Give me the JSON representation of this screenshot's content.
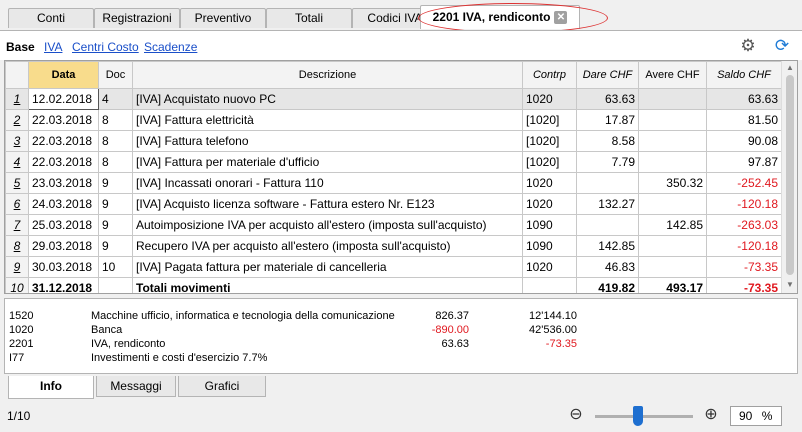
{
  "tabs": [
    "Conti",
    "Registrazioni",
    "Preventivo",
    "Totali",
    "Codici IVA",
    "2201 IVA, rendiconto"
  ],
  "views": [
    "Base",
    "IVA",
    "Centri Costo",
    "Scadenze"
  ],
  "icons": {
    "settings": "gear-icon",
    "refresh": "refresh-icon",
    "close": "close-icon",
    "zoom_out": "zoom-out-icon",
    "zoom_in": "zoom-in-icon"
  },
  "colors": {
    "negative": "#e0181f",
    "selected_header": "#f8dc8c",
    "highlight_ellipse": "#dd3333"
  },
  "table": {
    "headers": [
      "Data",
      "Doc",
      "Descrizione",
      "Contrp",
      "Dare CHF",
      "Avere CHF",
      "Saldo CHF"
    ],
    "rows": [
      {
        "n": "1",
        "date": "12.02.2018",
        "doc": "4",
        "desc": "[IVA] Acquistato nuovo PC",
        "contrp": "1020",
        "dare": "63.63",
        "avere": "",
        "saldo": "63.63"
      },
      {
        "n": "2",
        "date": "22.03.2018",
        "doc": "8",
        "desc": "[IVA] Fattura elettricità",
        "contrp": "[1020]",
        "dare": "17.87",
        "avere": "",
        "saldo": "81.50"
      },
      {
        "n": "3",
        "date": "22.03.2018",
        "doc": "8",
        "desc": "[IVA] Fattura telefono",
        "contrp": "[1020]",
        "dare": "8.58",
        "avere": "",
        "saldo": "90.08"
      },
      {
        "n": "4",
        "date": "22.03.2018",
        "doc": "8",
        "desc": "[IVA] Fattura per materiale d'ufficio",
        "contrp": "[1020]",
        "dare": "7.79",
        "avere": "",
        "saldo": "97.87"
      },
      {
        "n": "5",
        "date": "23.03.2018",
        "doc": "9",
        "desc": "[IVA] Incassati onorari - Fattura 110",
        "contrp": "1020",
        "dare": "",
        "avere": "350.32",
        "saldo": "-252.45"
      },
      {
        "n": "6",
        "date": "24.03.2018",
        "doc": "9",
        "desc": "[IVA] Acquisto licenza software - Fattura estero Nr. E123",
        "contrp": "1020",
        "dare": "132.27",
        "avere": "",
        "saldo": "-120.18"
      },
      {
        "n": "7",
        "date": "25.03.2018",
        "doc": "9",
        "desc": "Autoimposizione IVA per acquisto all'estero (imposta sull'acquisto)",
        "contrp": "1090",
        "dare": "",
        "avere": "142.85",
        "saldo": "-263.03"
      },
      {
        "n": "8",
        "date": "29.03.2018",
        "doc": "9",
        "desc": "Recupero IVA per acquisto all'estero (imposta sull'acquisto)",
        "contrp": "1090",
        "dare": "142.85",
        "avere": "",
        "saldo": "-120.18"
      },
      {
        "n": "9",
        "date": "30.03.2018",
        "doc": "10",
        "desc": "[IVA] Pagata fattura per materiale di cancelleria",
        "contrp": "1020",
        "dare": "46.83",
        "avere": "",
        "saldo": "-73.35"
      },
      {
        "n": "10",
        "date": "31.12.2018",
        "doc": "",
        "desc": "Totali movimenti",
        "contrp": "",
        "dare": "419.82",
        "avere": "493.17",
        "saldo": "-73.35"
      }
    ]
  },
  "info_lines": [
    {
      "code": "1520",
      "desc": "Macchine ufficio, informatica e tecnologia della comunicazione",
      "v1": "826.37",
      "v2": "12'144.10",
      "v1neg": false,
      "v2neg": false
    },
    {
      "code": "1020",
      "desc": "Banca",
      "v1": "-890.00",
      "v2": "42'536.00",
      "v1neg": true,
      "v2neg": false
    },
    {
      "code": "2201",
      "desc": "IVA, rendiconto",
      "v1": "63.63",
      "v2": "-73.35",
      "v1neg": false,
      "v2neg": true
    },
    {
      "code": "I77",
      "desc": "Investimenti e costi d'esercizio 7.7%",
      "v1": "",
      "v2": "",
      "v1neg": false,
      "v2neg": false
    }
  ],
  "bottom_tabs": [
    "Info",
    "Messaggi",
    "Grafici"
  ],
  "status": {
    "row_count": "1/10",
    "zoom_level": "90",
    "zoom_unit": "%"
  }
}
